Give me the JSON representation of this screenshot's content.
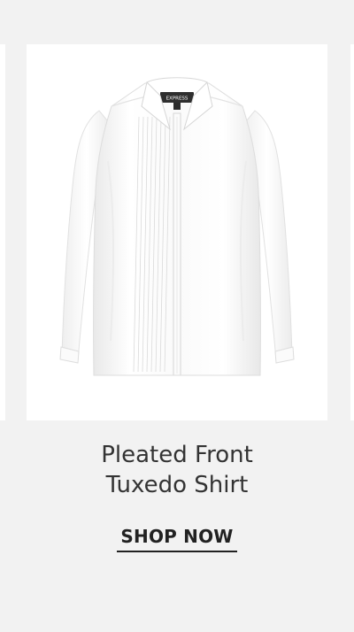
{
  "product": {
    "title_line_1": "Pleated Front",
    "title_line_2": "Tuxedo Shirt",
    "image_alt": "White pleated front tuxedo shirt",
    "brand_tag": "EXPRESS"
  },
  "cta": {
    "label": "SHOP NOW"
  },
  "colors": {
    "background": "#f2f2f2",
    "card": "#ffffff",
    "text": "#333333",
    "cta": "#222222"
  }
}
